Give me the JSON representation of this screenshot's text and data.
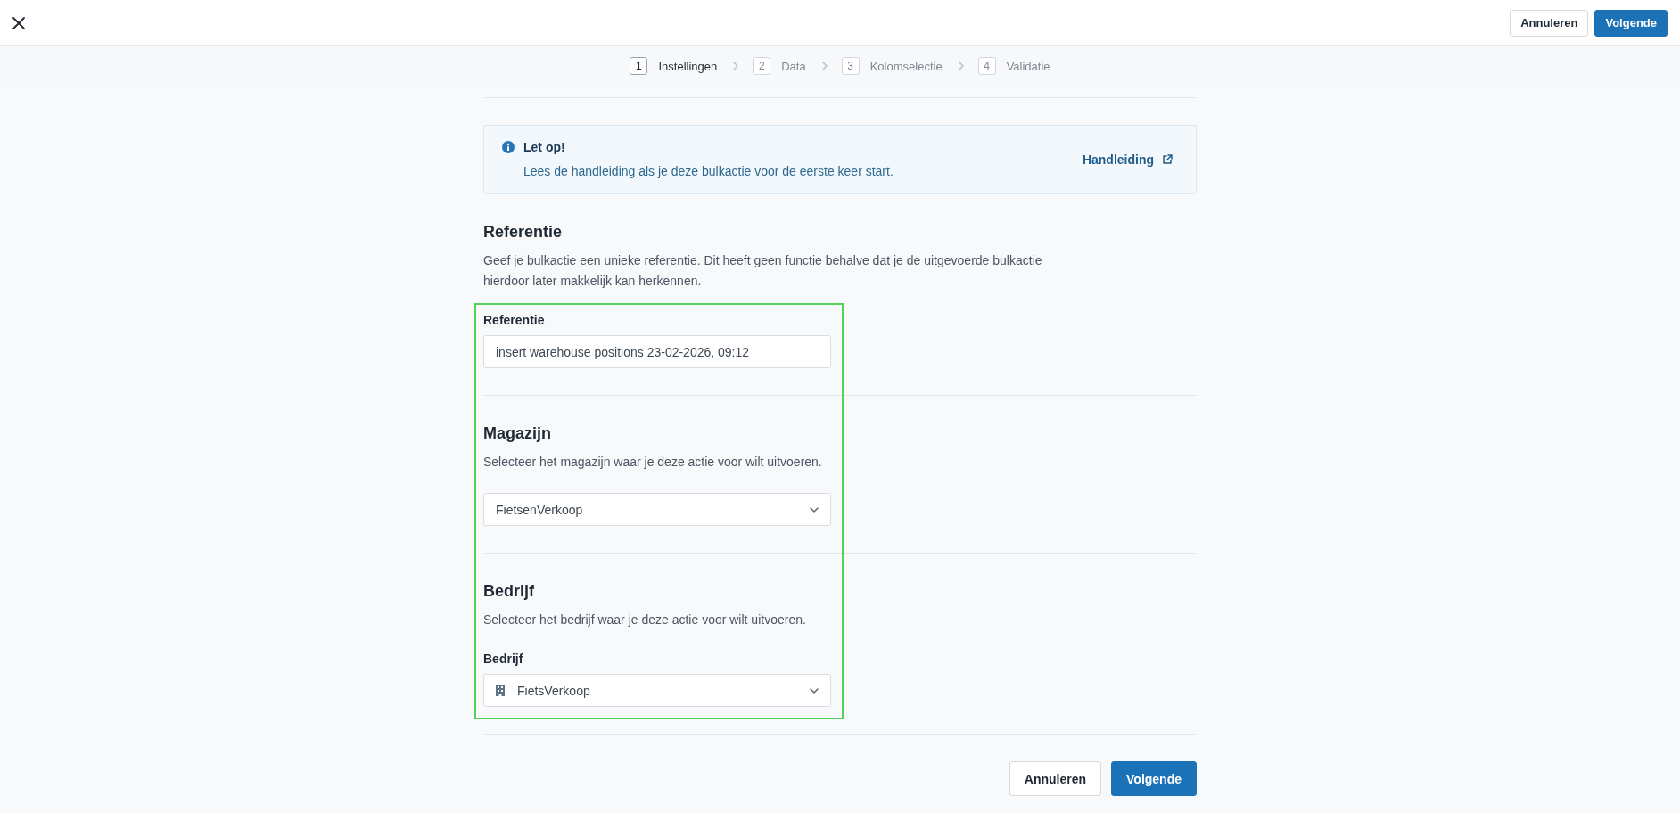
{
  "header": {
    "buttons": [
      {
        "label": "Annuleren",
        "kind": "secondary"
      },
      {
        "label": "Volgende",
        "kind": "primary"
      }
    ]
  },
  "stepper": {
    "steps": [
      {
        "number": "1",
        "label": "Instellingen",
        "selected": true
      },
      {
        "number": "2",
        "label": "Data",
        "selected": false
      },
      {
        "number": "3",
        "label": "Kolomselectie",
        "selected": false
      },
      {
        "number": "4",
        "label": "Validatie",
        "selected": false
      }
    ]
  },
  "notice": {
    "title": "Let op!",
    "message": "Lees de handleiding als je deze bulkactie voor de eerste keer start.",
    "link": "Handleiding"
  },
  "sections": [
    {
      "title": "Referentie",
      "description": "Geef je bulkactie een unieke referentie. Dit heeft geen functie behalve dat je de uitgevoerde bulkactie hierdoor later makkelijk kan herkennen.",
      "field": {
        "kind": "text",
        "label": "Referentie",
        "value": "insert warehouse positions 23-02-2026, 09:12"
      }
    },
    {
      "title": "Magazijn",
      "description": "Selecteer het magazijn waar je deze actie voor wilt uitvoeren.",
      "field": {
        "kind": "select",
        "value": "FietsenVerkoop"
      }
    },
    {
      "title": "Bedrijf",
      "description": "Selecteer het bedrijf waar je deze actie voor wilt uitvoeren.",
      "field": {
        "kind": "company-select",
        "label": "Bedrijf",
        "value": "FietsVerkoop"
      }
    }
  ],
  "footer": {
    "buttons": [
      {
        "label": "Annuleren",
        "kind": "secondary"
      },
      {
        "label": "Volgende",
        "kind": "primary"
      }
    ]
  }
}
